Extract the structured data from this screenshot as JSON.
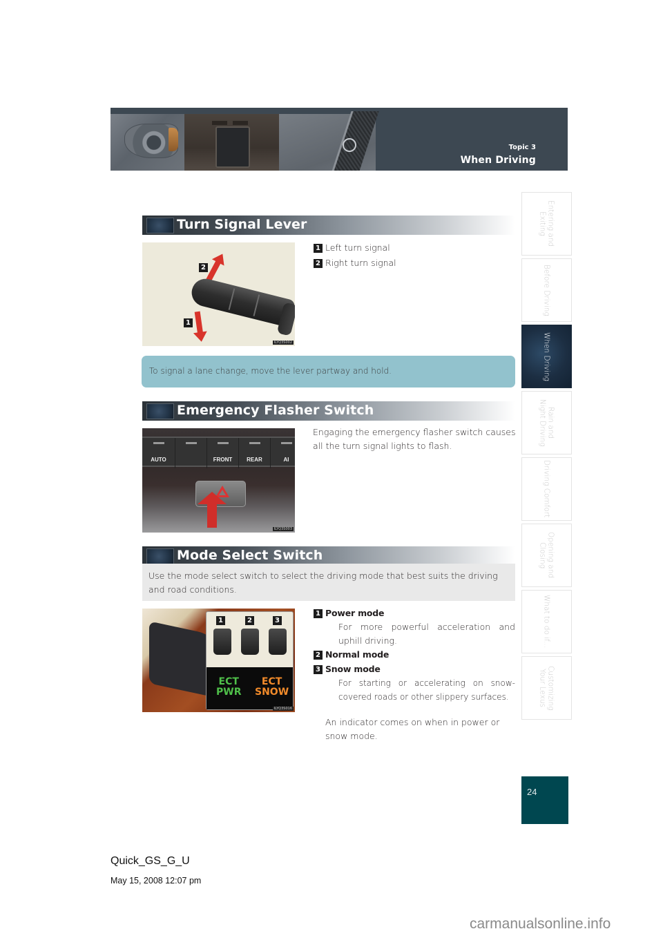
{
  "header": {
    "topic_label": "Topic 3",
    "section_title": "When Driving"
  },
  "sidebar": {
    "items": [
      {
        "label": "Entering and Exiting",
        "active": false
      },
      {
        "label": "Before Driving",
        "active": false
      },
      {
        "label": "When Driving",
        "active": true
      },
      {
        "label": "Rain and\nNight Driving",
        "active": false
      },
      {
        "label": "Driving Comfort",
        "active": false
      },
      {
        "label": "Opening and Closing",
        "active": false
      },
      {
        "label": "What to do if...",
        "active": false
      },
      {
        "label": "Customizing\nYour Lexus",
        "active": false
      }
    ]
  },
  "turn_signal": {
    "heading": "Turn Signal Lever",
    "image_code": "ILYQ3S002",
    "image_callouts": [
      "1",
      "2"
    ],
    "items": [
      {
        "num": "1",
        "label": "Left turn signal"
      },
      {
        "num": "2",
        "label": "Right turn signal"
      }
    ],
    "tip": "To signal a lane change, move the lever partway and hold."
  },
  "flasher": {
    "heading": "Emergency Flasher Switch",
    "image_code": "ILYQ3S003",
    "panel_keys": [
      "AUTO",
      "",
      "FRONT",
      "REAR",
      "AI"
    ],
    "description": "Engaging the emergency flasher switch causes all the turn signal lights to flash."
  },
  "mode_select": {
    "heading": "Mode Select Switch",
    "intro": "Use the mode select switch to select the driving mode that best suits the driving and road conditions.",
    "image_code": "ILYQ3S016",
    "image_callouts": [
      "1",
      "2",
      "3"
    ],
    "display_left": [
      "ECT",
      "PWR"
    ],
    "display_right": [
      "ECT",
      "SNOW"
    ],
    "items": [
      {
        "num": "1",
        "label": "Power mode",
        "desc": "For more powerful acceleration and uphill driving."
      },
      {
        "num": "2",
        "label": "Normal mode",
        "desc": ""
      },
      {
        "num": "3",
        "label": "Snow mode",
        "desc": "For starting or accelerating on snow-covered roads or other slippery surfaces."
      }
    ],
    "note": "An indicator comes on when in power or snow mode."
  },
  "colors": {
    "banner_bg": "#3d4852",
    "tip_bg": "#92c2cd",
    "page_box": "#004750",
    "arrow_red": "#d8342b",
    "ect_green": "#4fbf4a",
    "ect_orange": "#f08a2a"
  },
  "page": {
    "number": "24",
    "doc_id": "Quick_GS_G_U",
    "timestamp": "May 15, 2008 12:07 pm",
    "watermark": "carmanualsonline.info"
  }
}
